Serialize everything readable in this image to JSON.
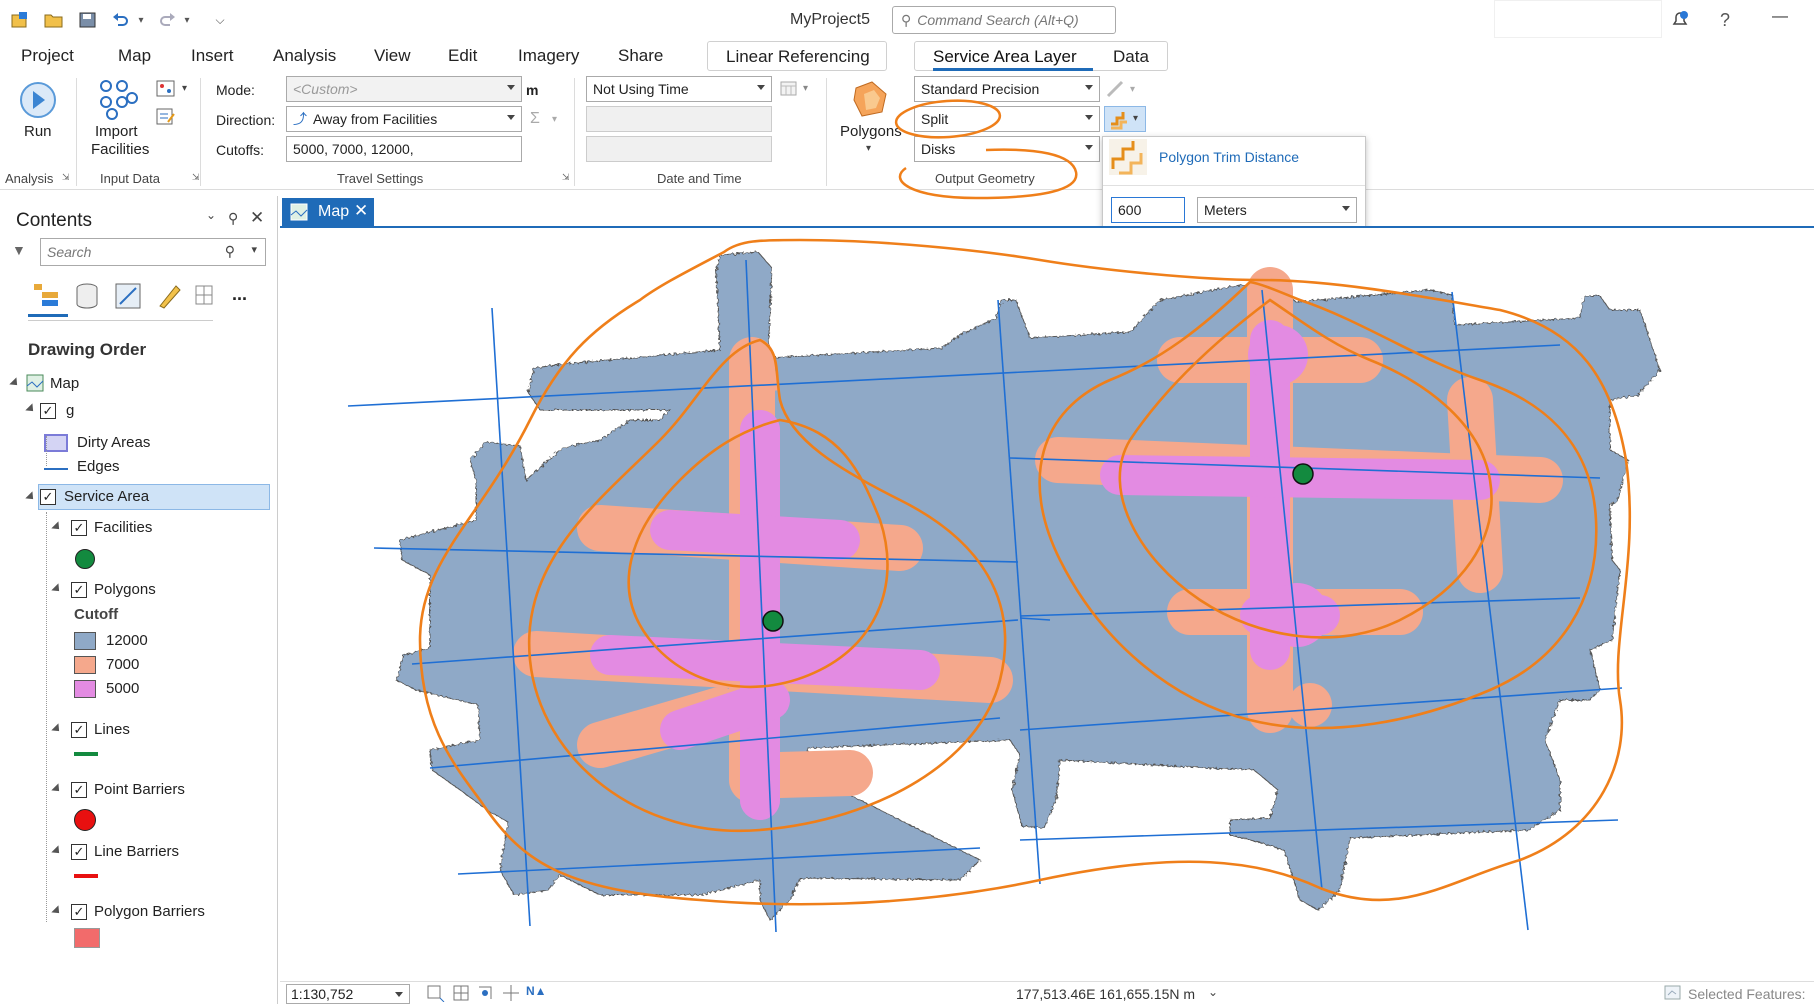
{
  "app": {
    "title": "MyProject5",
    "command_search_placeholder": "Command Search (Alt+Q)",
    "help": "?",
    "minimize": "—"
  },
  "tabs": [
    "Project",
    "Map",
    "Insert",
    "Analysis",
    "View",
    "Edit",
    "Imagery",
    "Share"
  ],
  "contextual_tabs": {
    "linear_referencing": "Linear Referencing",
    "service_area_layer": "Service Area Layer",
    "data": "Data"
  },
  "ribbon": {
    "run_label": "Run",
    "import_facilities_label_1": "Import",
    "import_facilities_label_2": "Facilities",
    "mode_label": "Mode:",
    "mode_value": "<Custom>",
    "mode_unit": "m",
    "direction_label": "Direction:",
    "direction_value": "Away from Facilities",
    "cutoffs_label": "Cutoffs:",
    "cutoffs_value": "5000, 7000, 12000,",
    "time_value": "Not Using Time",
    "polygons_label": "Polygons",
    "precision_value": "Standard Precision",
    "overlap_value": "Split",
    "shape_value": "Disks",
    "groups": {
      "analysis": "Analysis",
      "input_data": "Input Data",
      "travel_settings": "Travel Settings",
      "date_and_time": "Date and Time",
      "output_geometry": "Output Geometry"
    }
  },
  "popup": {
    "title": "Polygon Trim Distance",
    "value": "600",
    "unit": "Meters"
  },
  "contents": {
    "title": "Contents",
    "search_placeholder": "Search",
    "more": "...",
    "drawing_order": "Drawing Order",
    "map": "Map",
    "g": "g",
    "dirty_areas": "Dirty Areas",
    "edges": "Edges",
    "service_area": "Service Area",
    "facilities": "Facilities",
    "polygons": "Polygons",
    "cutoff": "Cutoff",
    "cutoff_12000": "12000",
    "cutoff_7000": "7000",
    "cutoff_5000": "5000",
    "lines": "Lines",
    "point_barriers": "Point Barriers",
    "line_barriers": "Line Barriers",
    "polygon_barriers": "Polygon Barriers"
  },
  "map_tab": {
    "label": "Map"
  },
  "status": {
    "scale": "1:130,752",
    "coords": "177,513.46E 161,655.15N m",
    "selected": "Selected Features:"
  },
  "colors": {
    "accent": "#1f6bb8",
    "poly_12000": "#8fa9c7",
    "poly_7000": "#f5a88c",
    "poly_5000": "#e38be2",
    "facility": "#138a3f",
    "annotation": "#ef7f1a",
    "edge": "#1f6fd4"
  }
}
